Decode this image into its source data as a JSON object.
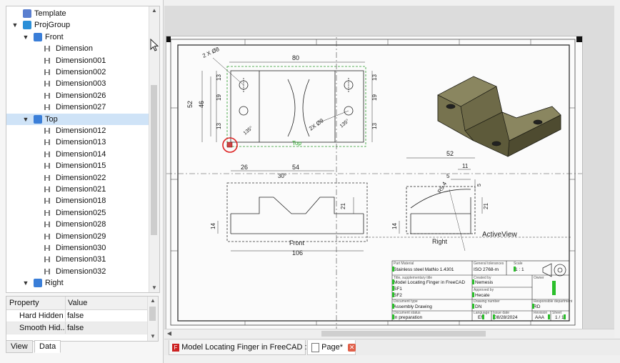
{
  "tree": {
    "items": [
      {
        "label": "Template",
        "icon": "template-icon"
      },
      {
        "label": "ProjGroup",
        "icon": "projgroup-icon"
      },
      {
        "label": "Front",
        "icon": "view-icon"
      },
      {
        "label": "Dimension",
        "icon": "horizontal-dimension-icon"
      },
      {
        "label": "Dimension001",
        "icon": "vertical-dimension-icon"
      },
      {
        "label": "Dimension002",
        "icon": "vertical-dimension-icon"
      },
      {
        "label": "Dimension003",
        "icon": "horizontal-dimension-icon"
      },
      {
        "label": "Dimension026",
        "icon": "radius-dimension-icon"
      },
      {
        "label": "Dimension027",
        "icon": "radius-dimension-icon"
      },
      {
        "label": "Top",
        "icon": "view-icon"
      },
      {
        "label": "Dimension012",
        "icon": "horizontal-dimension-icon"
      },
      {
        "label": "Dimension013",
        "icon": "vertical-dimension-icon"
      },
      {
        "label": "Dimension014",
        "icon": "angle-dimension-icon"
      },
      {
        "label": "Dimension015",
        "icon": "angle-dimension-icon"
      },
      {
        "label": "Dimension022",
        "icon": "diameter-dimension-icon"
      },
      {
        "label": "Dimension021",
        "icon": "diameter-dimension-icon"
      },
      {
        "label": "Dimension018",
        "icon": "angle-dimension-icon"
      },
      {
        "label": "Dimension025",
        "icon": "radius-dimension-icon"
      },
      {
        "label": "Dimension028",
        "icon": "radius-dimension-icon"
      },
      {
        "label": "Dimension029",
        "icon": "radius-dimension-icon"
      },
      {
        "label": "Dimension030",
        "icon": "radius-dimension-icon"
      },
      {
        "label": "Dimension031",
        "icon": "radius-dimension-icon"
      },
      {
        "label": "Dimension032",
        "icon": "radius-dimension-icon"
      },
      {
        "label": "Right",
        "icon": "view-icon"
      }
    ]
  },
  "properties": {
    "header": {
      "property": "Property",
      "value": "Value"
    },
    "rows": [
      {
        "name": "Hard Hidden",
        "value": "false"
      },
      {
        "name": "Smooth Hid...",
        "value": "false"
      }
    ]
  },
  "panel_tabs": {
    "view": "View",
    "data": "Data"
  },
  "doc_tabs": [
    {
      "label": "Model Locating Finger in FreeCAD : 1*"
    },
    {
      "label": "Page*"
    }
  ],
  "drawing": {
    "front_dims": {
      "width": "80",
      "height1": "52",
      "height2": "46",
      "h13a": "13",
      "h19": "19",
      "h13b": "13",
      "r13": "13",
      "r19": "19",
      "r13b": "13",
      "holes1": "2 X Ø8",
      "holes2": "2X Ø9",
      "ang1": "135°",
      "ang2": "135°"
    },
    "top_label": "Top",
    "front_view_dims": {
      "w26": "26",
      "w54": "54",
      "ang": "30°",
      "h21": "21",
      "h14": "14",
      "total": "106"
    },
    "front_label": "Front",
    "right_dims": {
      "w52": "52",
      "w11": "11",
      "w5": "5",
      "h5": "5",
      "h21": "21",
      "h14": "14",
      "r": "R5.4"
    },
    "right_label": "Right",
    "active_view": "ActiveView",
    "title_block": {
      "part_material_label": "Part Material",
      "part_material": "Stainless steel MatNo 1.4301",
      "tolerances_label": "General tolerances",
      "tolerances": "ISO 2768-m",
      "scale_label": "Scale",
      "scale": "1 : 1",
      "title_label": "Title, supplementary title",
      "title": "Model Locating Finger in FreeCAD",
      "sup1": "SF1",
      "sup2": "SF2",
      "created_label": "Created by",
      "created": "Nemesis",
      "approved_label": "Approved by",
      "approved": "Hecate",
      "owner_label": "Owner",
      "doc_type_label": "Document type",
      "doc_type": "Assembly Drawing",
      "drawing_no_label": "Drawing number",
      "drawing_no": "DN",
      "resp_label": "Responsible department",
      "resp": "RD",
      "status_label": "Document status",
      "status": "In preparation",
      "lang_label": "Language",
      "lang": "EN",
      "date_label": "Issue date",
      "date": "08/28/2024",
      "rev_label": "Revision",
      "rev": "AAA",
      "sheet_label": "Sheet",
      "sheet": "1 / 1"
    }
  },
  "colors": {
    "accent": "#2b6fc4",
    "green": "#22aa22",
    "selection": "#cfe3f7",
    "model": "#6f6b45"
  }
}
